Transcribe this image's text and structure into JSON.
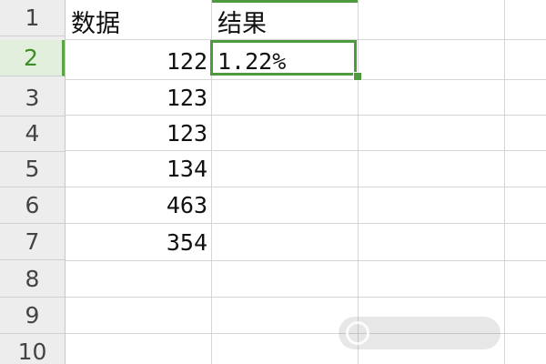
{
  "columns": [
    {
      "header": "数据"
    },
    {
      "header": "结果"
    }
  ],
  "rows": [
    {
      "num": "1"
    },
    {
      "num": "2"
    },
    {
      "num": "3"
    },
    {
      "num": "4"
    },
    {
      "num": "5"
    },
    {
      "num": "6"
    },
    {
      "num": "7"
    },
    {
      "num": "8"
    },
    {
      "num": "9"
    },
    {
      "num": "10"
    }
  ],
  "data_values": [
    "122",
    "123",
    "123",
    "134",
    "463",
    "354"
  ],
  "result_value": "1.22%",
  "active_cell": "C2",
  "colors": {
    "selection": "#4e9a3f",
    "row_header_bg": "#ededed",
    "active_row_bg": "#e3efdd",
    "gridline": "#d6d6d6"
  }
}
